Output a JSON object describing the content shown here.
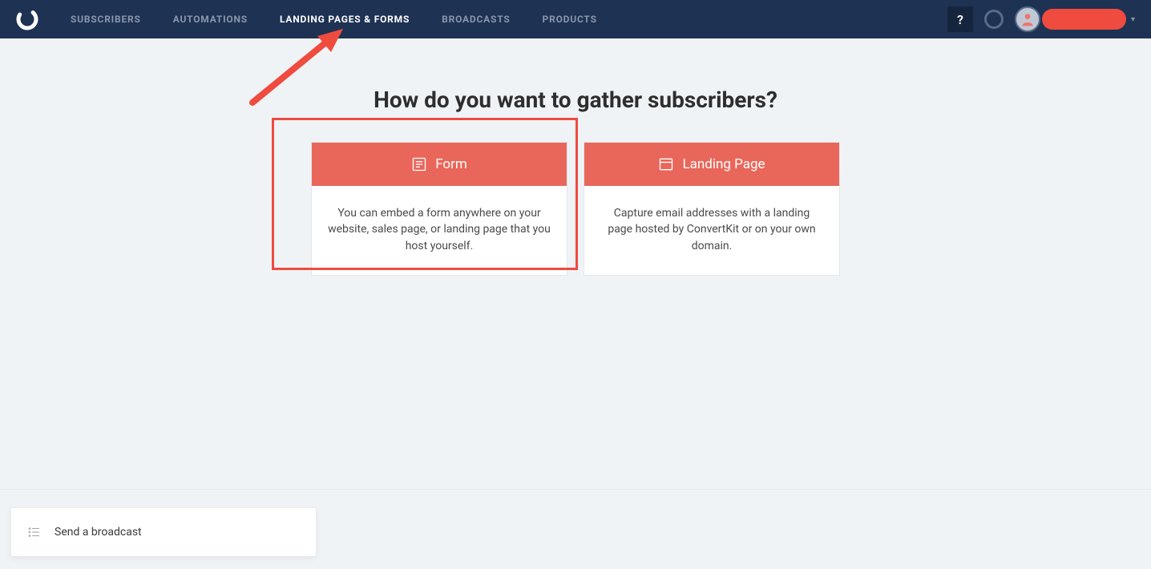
{
  "nav": {
    "items": [
      {
        "label": "SUBSCRIBERS",
        "active": false
      },
      {
        "label": "AUTOMATIONS",
        "active": false
      },
      {
        "label": "LANDING PAGES & FORMS",
        "active": true
      },
      {
        "label": "BROADCASTS",
        "active": false
      },
      {
        "label": "PRODUCTS",
        "active": false
      }
    ],
    "help_label": "?"
  },
  "main": {
    "heading": "How do you want to gather subscribers?",
    "cards": [
      {
        "title": "Form",
        "icon": "form-icon",
        "description": "You can embed a form anywhere on your website, sales page, or landing page that you host yourself."
      },
      {
        "title": "Landing Page",
        "icon": "browser-icon",
        "description": "Capture email addresses with a landing page hosted by ConvertKit or on your own domain."
      }
    ]
  },
  "footer": {
    "broadcast_label": "Send a broadcast"
  }
}
